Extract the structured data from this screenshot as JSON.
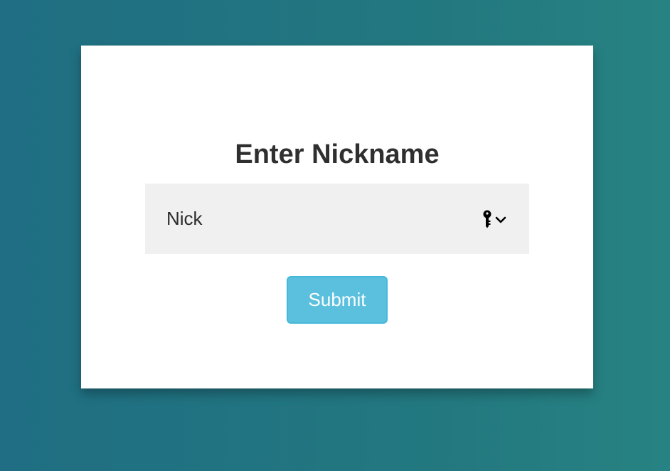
{
  "form": {
    "title": "Enter Nickname",
    "nickname_value": "Nick",
    "autofill_icons": [
      "key-icon",
      "chevron-down-icon"
    ],
    "submit_label": "Submit"
  },
  "colors": {
    "background": "#23797f",
    "card": "#ffffff",
    "input_background": "#f0f0f0",
    "button": "#5bc0de",
    "button_border": "#46b8da",
    "text": "#2f2f2f"
  }
}
